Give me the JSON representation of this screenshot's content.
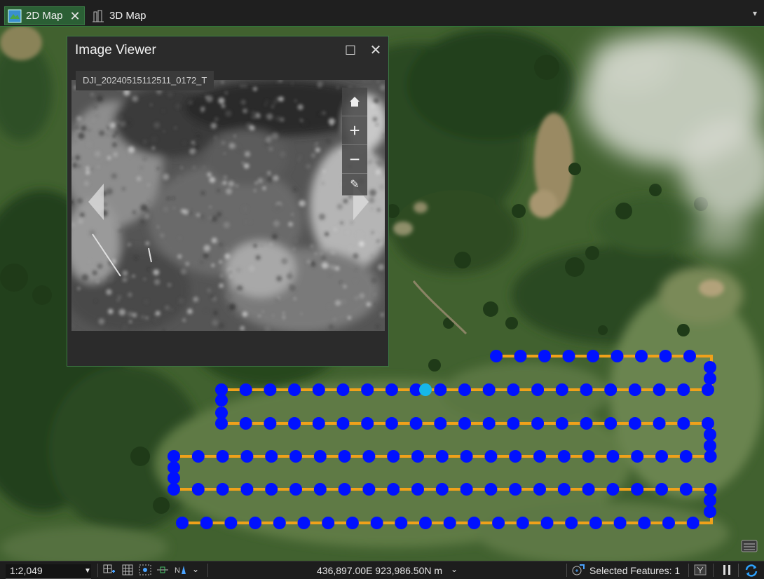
{
  "tabs": [
    {
      "label": "2D Map",
      "icon": "map-icon",
      "active": true
    },
    {
      "label": "3D Map",
      "icon": "globe-scene-icon",
      "active": false
    }
  ],
  "image_viewer": {
    "title": "Image Viewer",
    "image_name": "DJI_20240515112511_0172_T"
  },
  "status": {
    "scale": "1:2,049",
    "coordinates": "436,897.00E 923,986.50N m",
    "selected_features": "Selected Features: 1"
  },
  "colors": {
    "accent": "#2e7a3b",
    "flight_line": "#f0a11a",
    "point": "#0011ff",
    "selected_point": "#17b8e8"
  }
}
